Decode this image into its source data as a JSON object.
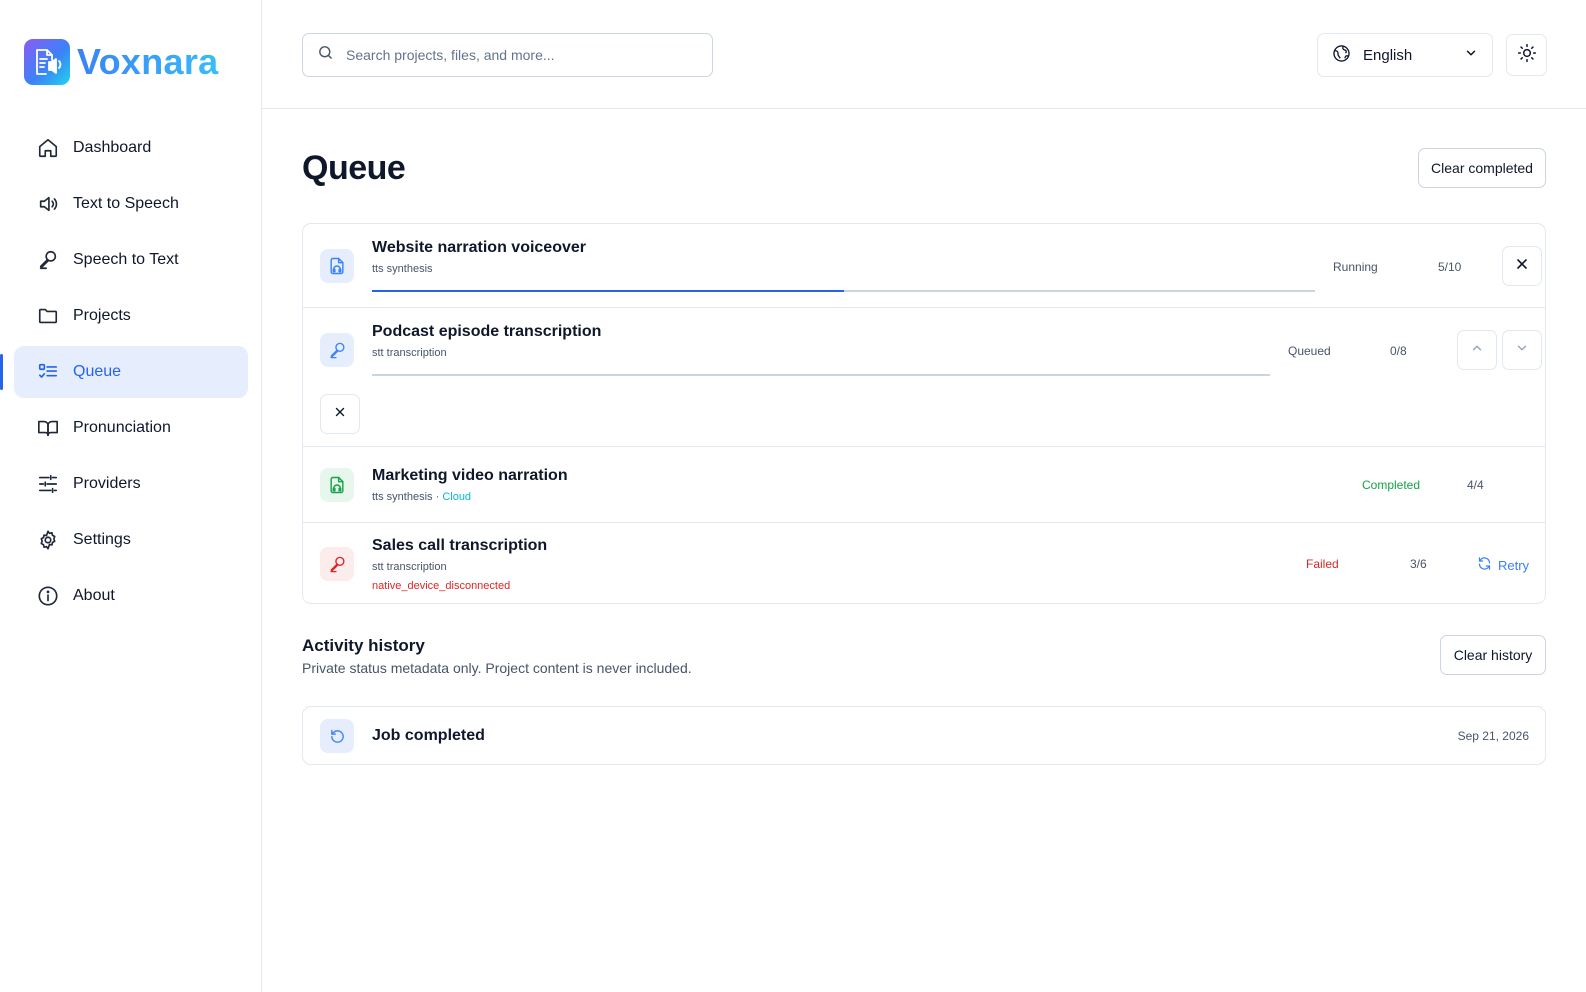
{
  "app": {
    "name": "Voxnara"
  },
  "sidebar": {
    "items": [
      {
        "label": "Dashboard",
        "icon": "home-icon"
      },
      {
        "label": "Text to Speech",
        "icon": "speaker-icon"
      },
      {
        "label": "Speech to Text",
        "icon": "microphone-icon"
      },
      {
        "label": "Projects",
        "icon": "folder-icon"
      },
      {
        "label": "Queue",
        "icon": "list-icon",
        "active": true
      },
      {
        "label": "Pronunciation",
        "icon": "book-icon"
      },
      {
        "label": "Providers",
        "icon": "sliders-icon"
      },
      {
        "label": "Settings",
        "icon": "gear-icon"
      },
      {
        "label": "About",
        "icon": "info-icon"
      }
    ]
  },
  "topbar": {
    "search_placeholder": "Search projects, files, and more...",
    "language": "English"
  },
  "page": {
    "title": "Queue",
    "clear_completed_label": "Clear completed"
  },
  "jobs": [
    {
      "title": "Website narration voiceover",
      "subtitle": "tts synthesis",
      "status": "Running",
      "count": "5/10",
      "progress": 0.5
    },
    {
      "title": "Podcast episode transcription",
      "subtitle": "stt transcription",
      "status": "Queued",
      "count": "0/8",
      "progress": 0
    },
    {
      "title": "Marketing video narration",
      "subtitle": "tts synthesis",
      "subtitle_sep": " · ",
      "subtitle_extra": "Cloud",
      "status": "Completed",
      "count": "4/4"
    },
    {
      "title": "Sales call transcription",
      "subtitle": "stt transcription",
      "error": "native_device_disconnected",
      "status": "Failed",
      "count": "3/6",
      "action_label": "Retry"
    }
  ],
  "history": {
    "title": "Activity history",
    "subtitle": "Private status metadata only. Project content is never included.",
    "clear_label": "Clear history",
    "items": [
      {
        "title": "Job completed",
        "date": "Sep 21, 2026"
      }
    ]
  },
  "colors": {
    "accent": "#2563eb",
    "success": "#16a34a",
    "danger": "#dc2626",
    "cloud": "#06b6d4"
  }
}
